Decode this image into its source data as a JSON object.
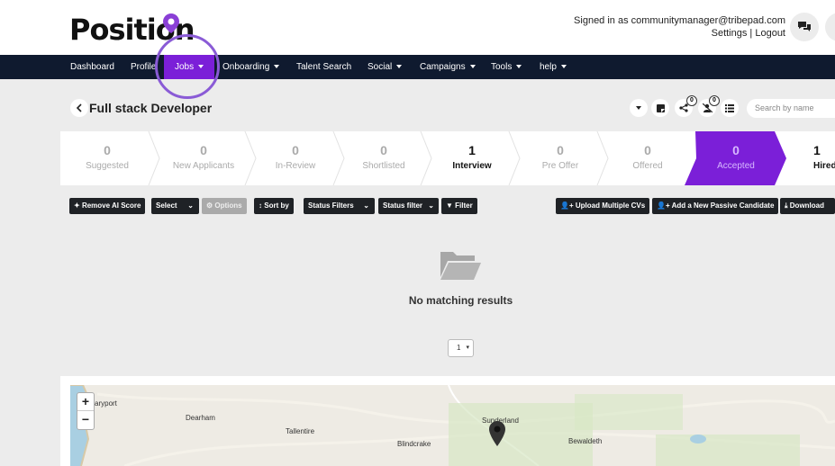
{
  "header": {
    "logo_text": "Position",
    "signed_in_text": "Signed in as communitymanager@tribepad.com",
    "settings_label": "Settings",
    "separator": " | ",
    "logout_label": "Logout"
  },
  "nav": {
    "items": [
      {
        "label": "Dashboard"
      },
      {
        "label": "Profile"
      },
      {
        "label": "Jobs"
      },
      {
        "label": "Onboarding"
      },
      {
        "label": "Talent Search"
      },
      {
        "label": "Social"
      },
      {
        "label": "Campaigns"
      },
      {
        "label": "Tools"
      },
      {
        "label": "help"
      }
    ]
  },
  "job": {
    "title": "Full stack Developer",
    "share_count": "0",
    "unassigned_count": "0",
    "search_placeholder": "Search by name"
  },
  "pipeline": [
    {
      "count": "0",
      "label": "Suggested"
    },
    {
      "count": "0",
      "label": "New Applicants"
    },
    {
      "count": "0",
      "label": "In-Review"
    },
    {
      "count": "0",
      "label": "Shortlisted"
    },
    {
      "count": "1",
      "label": "Interview"
    },
    {
      "count": "0",
      "label": "Pre Offer"
    },
    {
      "count": "0",
      "label": "Offered"
    },
    {
      "count": "0",
      "label": "Accepted"
    },
    {
      "count": "1",
      "label": "Hired"
    }
  ],
  "toolbar": {
    "remove_ai": "Remove AI Score",
    "select": "Select",
    "options": "Options",
    "sort_by": "Sort by",
    "status_filters": "Status Filters",
    "status_filter": "Status filter",
    "filter": "Filter",
    "upload_cvs": "Upload Multiple CVs",
    "add_passive": "Add a New Passive Candidate",
    "download": "Download"
  },
  "results": {
    "empty_text": "No matching results",
    "page": "1"
  },
  "map": {
    "zoom_in": "+",
    "zoom_out": "−",
    "places": [
      "aryport",
      "Dearham",
      "Tallentire",
      "Blindcrake",
      "Sunderland",
      "Bewaldeth"
    ]
  },
  "colors": {
    "navbar": "#0f1a2f",
    "active_nav": "#7b1fd8",
    "accepted_stage": "#7b1fd8",
    "logo_pin": "#8a3fd6"
  }
}
